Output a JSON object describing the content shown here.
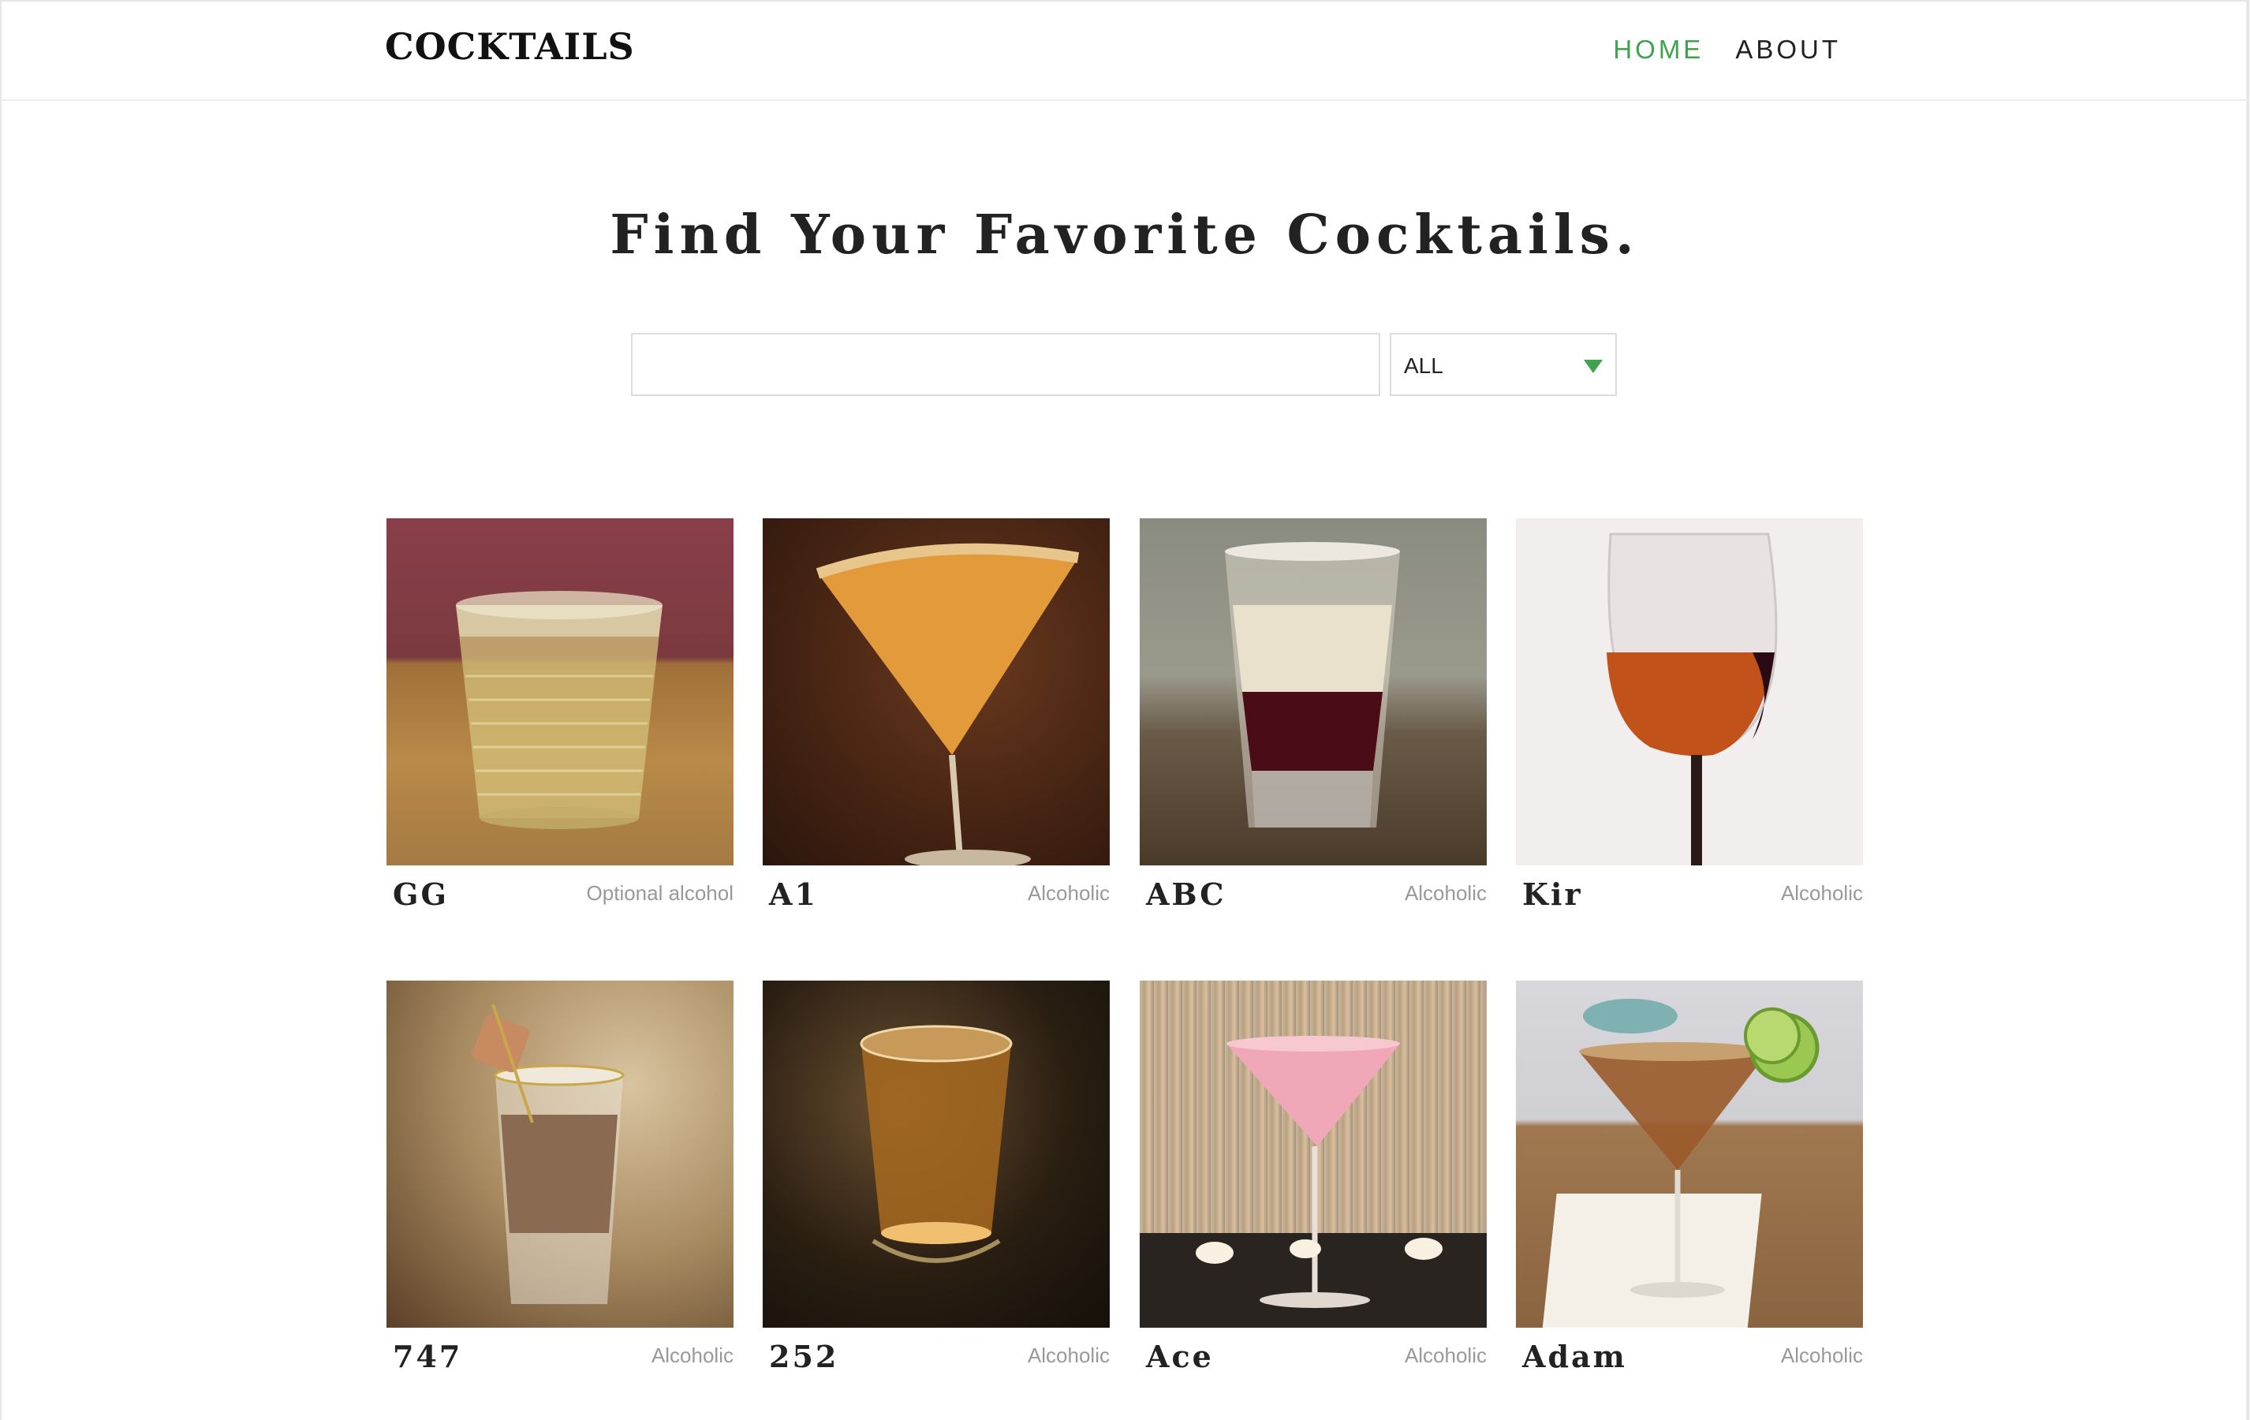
{
  "header": {
    "logo": "COCKTAILS",
    "nav": [
      {
        "label": "HOME",
        "active": true
      },
      {
        "label": "ABOUT",
        "active": false
      }
    ],
    "accent_color": "#3fa34d"
  },
  "hero": {
    "title": "Find Your Favorite Cocktails."
  },
  "search": {
    "value": "",
    "placeholder": "",
    "filter_selected": "ALL"
  },
  "cocktails": [
    {
      "name": "GG",
      "type": "Optional alcohol",
      "image": "rocks-glass-yellow-drink"
    },
    {
      "name": "A1",
      "type": "Alcoholic",
      "image": "martini-glass-orange-drink"
    },
    {
      "name": "ABC",
      "type": "Alcoholic",
      "image": "shot-glass-layered-drink"
    },
    {
      "name": "Kir",
      "type": "Alcoholic",
      "image": "wine-glass-red-drink"
    },
    {
      "name": "747",
      "type": "Alcoholic",
      "image": "shot-glass-creamy-drink"
    },
    {
      "name": "252",
      "type": "Alcoholic",
      "image": "shot-glass-amber-drink"
    },
    {
      "name": "Ace",
      "type": "Alcoholic",
      "image": "martini-glass-pink-drink"
    },
    {
      "name": "Adam",
      "type": "Alcoholic",
      "image": "martini-glass-lime-garnish"
    }
  ]
}
